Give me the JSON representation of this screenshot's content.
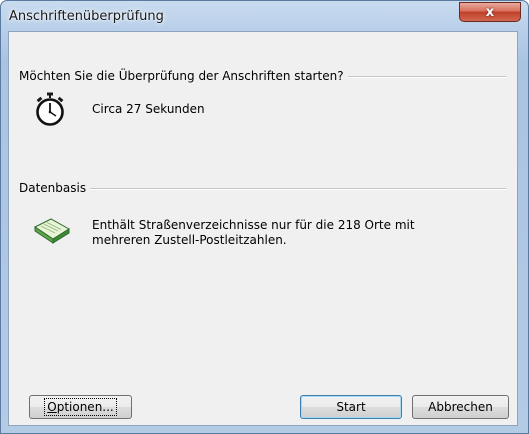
{
  "window": {
    "title": "Anschriftenüberprüfung",
    "close_glyph": "x"
  },
  "start_section": {
    "heading": "Möchten Sie die Überprüfung der Anschriften starten?",
    "duration_text": "Circa 27 Sekunden",
    "icon": "stopwatch-icon"
  },
  "data_section": {
    "heading": "Datenbasis",
    "text_line1": "Enthält Straßenverzeichnisse nur für die 218 Orte mit",
    "text_line2": "mehreren Zustell-Postleitzahlen.",
    "icon": "open-book-icon"
  },
  "buttons": {
    "options_mnemonic": "O",
    "options_rest": "ptionen...",
    "start_label": "Start",
    "cancel_label": "Abbrechen"
  },
  "colors": {
    "title_bar": "#b8cfe9",
    "close_button": "#c0412a",
    "dialog_background": "#f0f0f0"
  }
}
